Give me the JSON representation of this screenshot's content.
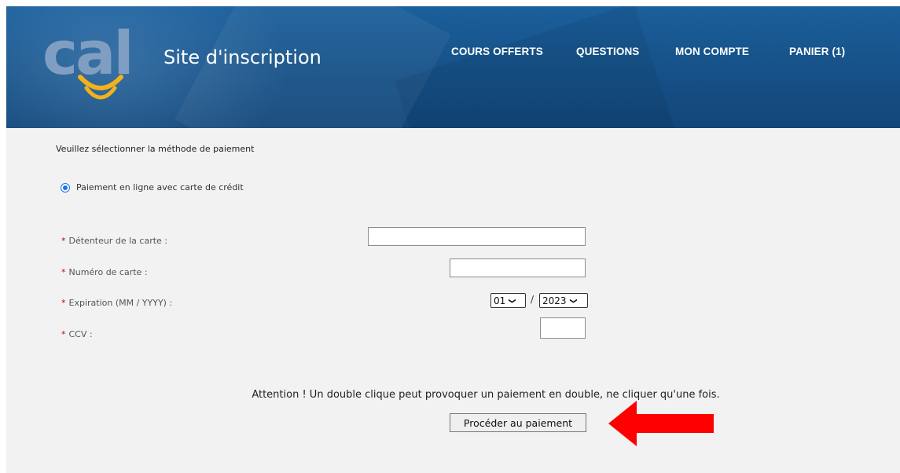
{
  "header": {
    "logo_text": "cal",
    "site_title": "Site d'inscription",
    "nav": [
      "COURS OFFERTS",
      "QUESTIONS",
      "MON COMPTE",
      "PANIER (1)"
    ]
  },
  "payment": {
    "method_prompt": "Veuillez sélectionner la méthode de paiement",
    "option_label": "Paiement en ligne avec carte de crédit",
    "required_mark": "*",
    "fields": {
      "holder_label": "Détenteur de la carte :",
      "number_label": "Numéro de carte :",
      "expiration_label": "Expiration (MM / YYYY) :",
      "ccv_label": "CCV :"
    },
    "expiration": {
      "month": "01",
      "separator": "/",
      "year": "2023"
    },
    "warning": "Attention ! Un double clique peut provoquer un paiement en double, ne cliquer qu'une fois.",
    "submit_label": "Procéder au paiement"
  },
  "colors": {
    "header_blue": "#17538a",
    "required_red": "#cc0000",
    "arrow_red": "#ff0000",
    "logo_grey_blue": "#7f9ec2",
    "logo_yellow": "#f2b21a"
  }
}
